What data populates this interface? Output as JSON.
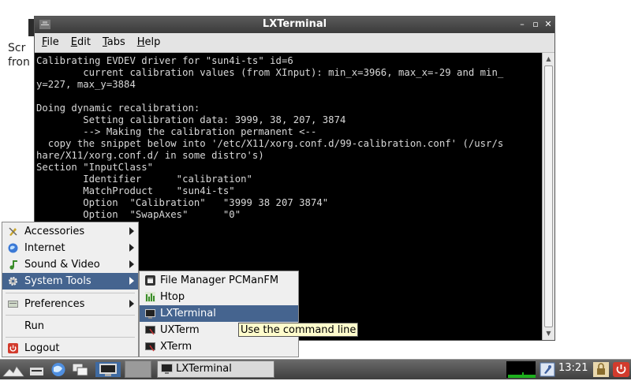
{
  "desktop": {
    "icon_label_lines": [
      "Scr",
      "fron"
    ]
  },
  "window": {
    "title": "LXTerminal",
    "controls": {
      "minimize": "–",
      "maximize": "▫",
      "close": "✕"
    },
    "menu": [
      {
        "mn": "F",
        "rest": "ile"
      },
      {
        "mn": "E",
        "rest": "dit"
      },
      {
        "mn": "T",
        "rest": "abs"
      },
      {
        "mn": "H",
        "rest": "elp"
      }
    ],
    "terminal_text": "Calibrating EVDEV driver for \"sun4i-ts\" id=6\n        current calibration values (from XInput): min_x=3966, max_x=-29 and min_\ny=227, max_y=3884\n\nDoing dynamic recalibration:\n        Setting calibration data: 3999, 38, 207, 3874\n        --> Making the calibration permanent <--\n  copy the snippet below into '/etc/X11/xorg.conf.d/99-calibration.conf' (/usr/s\nhare/X11/xorg.conf.d/ in some distro's)\nSection \"InputClass\"\n        Identifier      \"calibration\"\n        MatchProduct    \"sun4i-ts\"\n        Option  \"Calibration\"   \"3999 38 207 3874\"\n        Option  \"SwapAxes\"      \"0\""
  },
  "start_menu": {
    "items": [
      {
        "label": "Accessories",
        "icon": "accessories-icon"
      },
      {
        "label": "Internet",
        "icon": "internet-globe-icon"
      },
      {
        "label": "Sound & Video",
        "icon": "music-note-icon"
      },
      {
        "label": "System Tools",
        "icon": "gear-icon",
        "selected": true
      },
      {
        "label": "Preferences",
        "icon": "preferences-icon"
      },
      {
        "label": "Run",
        "icon": ""
      },
      {
        "label": "Logout",
        "icon": "power-icon"
      }
    ]
  },
  "submenu": {
    "items": [
      {
        "label": "File Manager PCManFM",
        "icon": "file-manager-icon"
      },
      {
        "label": "Htop",
        "icon": "htop-icon"
      },
      {
        "label": "LXTerminal",
        "icon": "terminal-icon",
        "selected": true
      },
      {
        "label": "UXTerm",
        "icon": "terminal-icon"
      },
      {
        "label": "XTerm",
        "icon": "terminal-icon"
      }
    ]
  },
  "tooltip": "Use the command line",
  "taskbar": {
    "task_label": "LXTerminal",
    "clock": "13:21"
  },
  "colors": {
    "selection": "#45648f",
    "terminal_bg": "#000000",
    "terminal_fg": "#d8d8d8",
    "tooltip_bg": "#fffccc"
  }
}
